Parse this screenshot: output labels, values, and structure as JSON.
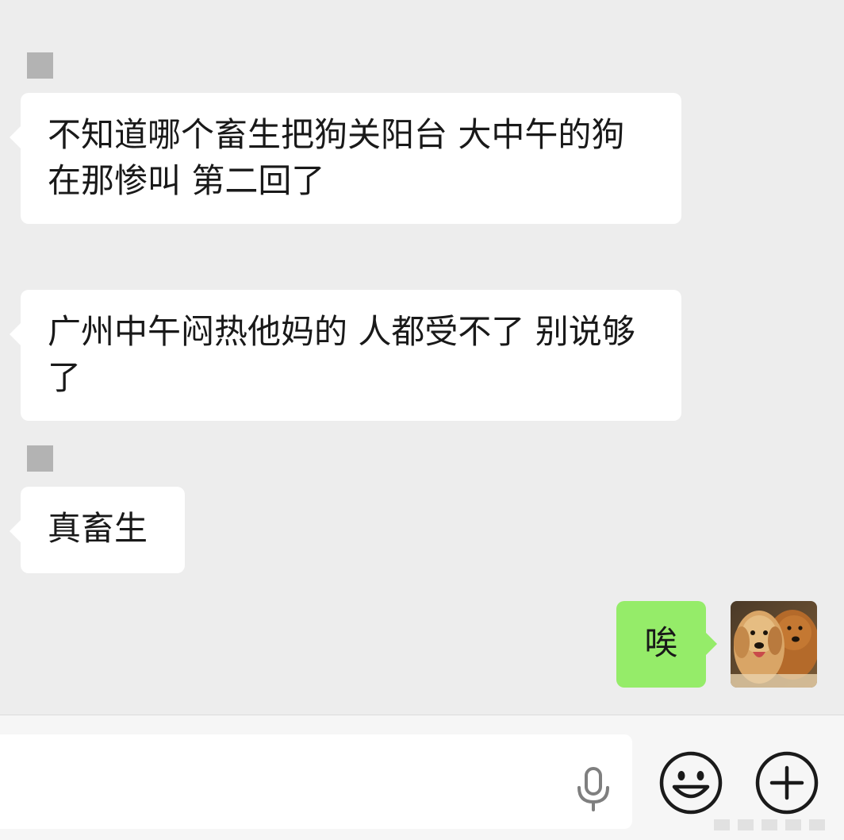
{
  "messages": [
    {
      "id": "m1",
      "direction": "incoming",
      "text": "不知道哪个畜生把狗关阳台 大中午的狗在那惨叫 第二回了"
    },
    {
      "id": "m2",
      "direction": "incoming",
      "text": "广州中午闷热他妈的 人都受不了 别说够了"
    },
    {
      "id": "m3",
      "direction": "incoming",
      "text": "真畜生"
    },
    {
      "id": "m4",
      "direction": "outgoing",
      "text": "唉"
    }
  ],
  "input_bar": {
    "message_value": "",
    "icons": [
      "microphone-icon",
      "emoji-icon",
      "plus-icon"
    ]
  },
  "colors": {
    "background": "#ededed",
    "incoming_bubble": "#ffffff",
    "outgoing_bubble": "#95ec69",
    "text": "#191919"
  }
}
